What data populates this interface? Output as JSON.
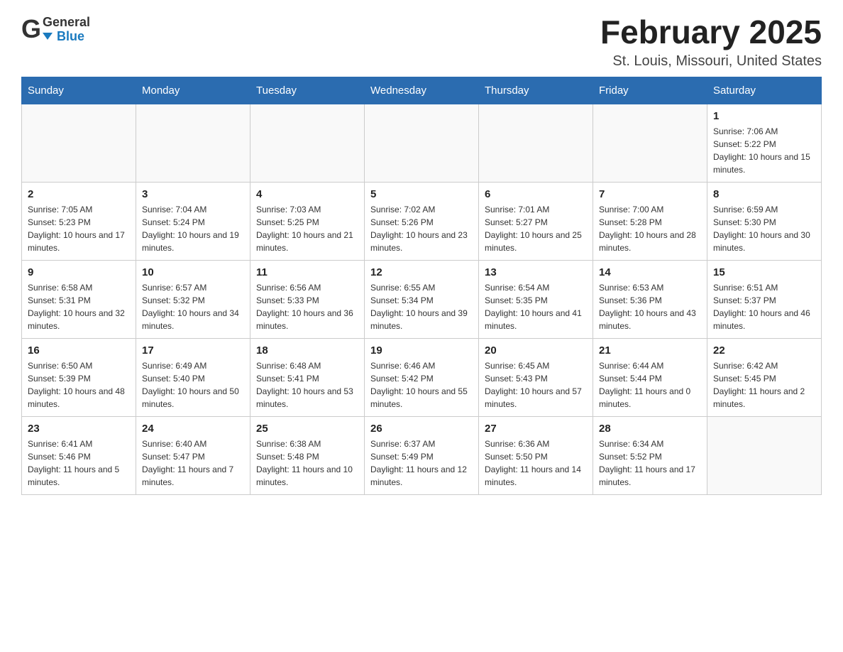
{
  "header": {
    "logo": {
      "general": "General",
      "arrow": "▶",
      "blue": "Blue"
    },
    "title": "February 2025",
    "location": "St. Louis, Missouri, United States"
  },
  "weekdays": [
    "Sunday",
    "Monday",
    "Tuesday",
    "Wednesday",
    "Thursday",
    "Friday",
    "Saturday"
  ],
  "weeks": [
    [
      {
        "day": "",
        "info": ""
      },
      {
        "day": "",
        "info": ""
      },
      {
        "day": "",
        "info": ""
      },
      {
        "day": "",
        "info": ""
      },
      {
        "day": "",
        "info": ""
      },
      {
        "day": "",
        "info": ""
      },
      {
        "day": "1",
        "info": "Sunrise: 7:06 AM\nSunset: 5:22 PM\nDaylight: 10 hours and 15 minutes."
      }
    ],
    [
      {
        "day": "2",
        "info": "Sunrise: 7:05 AM\nSunset: 5:23 PM\nDaylight: 10 hours and 17 minutes."
      },
      {
        "day": "3",
        "info": "Sunrise: 7:04 AM\nSunset: 5:24 PM\nDaylight: 10 hours and 19 minutes."
      },
      {
        "day": "4",
        "info": "Sunrise: 7:03 AM\nSunset: 5:25 PM\nDaylight: 10 hours and 21 minutes."
      },
      {
        "day": "5",
        "info": "Sunrise: 7:02 AM\nSunset: 5:26 PM\nDaylight: 10 hours and 23 minutes."
      },
      {
        "day": "6",
        "info": "Sunrise: 7:01 AM\nSunset: 5:27 PM\nDaylight: 10 hours and 25 minutes."
      },
      {
        "day": "7",
        "info": "Sunrise: 7:00 AM\nSunset: 5:28 PM\nDaylight: 10 hours and 28 minutes."
      },
      {
        "day": "8",
        "info": "Sunrise: 6:59 AM\nSunset: 5:30 PM\nDaylight: 10 hours and 30 minutes."
      }
    ],
    [
      {
        "day": "9",
        "info": "Sunrise: 6:58 AM\nSunset: 5:31 PM\nDaylight: 10 hours and 32 minutes."
      },
      {
        "day": "10",
        "info": "Sunrise: 6:57 AM\nSunset: 5:32 PM\nDaylight: 10 hours and 34 minutes."
      },
      {
        "day": "11",
        "info": "Sunrise: 6:56 AM\nSunset: 5:33 PM\nDaylight: 10 hours and 36 minutes."
      },
      {
        "day": "12",
        "info": "Sunrise: 6:55 AM\nSunset: 5:34 PM\nDaylight: 10 hours and 39 minutes."
      },
      {
        "day": "13",
        "info": "Sunrise: 6:54 AM\nSunset: 5:35 PM\nDaylight: 10 hours and 41 minutes."
      },
      {
        "day": "14",
        "info": "Sunrise: 6:53 AM\nSunset: 5:36 PM\nDaylight: 10 hours and 43 minutes."
      },
      {
        "day": "15",
        "info": "Sunrise: 6:51 AM\nSunset: 5:37 PM\nDaylight: 10 hours and 46 minutes."
      }
    ],
    [
      {
        "day": "16",
        "info": "Sunrise: 6:50 AM\nSunset: 5:39 PM\nDaylight: 10 hours and 48 minutes."
      },
      {
        "day": "17",
        "info": "Sunrise: 6:49 AM\nSunset: 5:40 PM\nDaylight: 10 hours and 50 minutes."
      },
      {
        "day": "18",
        "info": "Sunrise: 6:48 AM\nSunset: 5:41 PM\nDaylight: 10 hours and 53 minutes."
      },
      {
        "day": "19",
        "info": "Sunrise: 6:46 AM\nSunset: 5:42 PM\nDaylight: 10 hours and 55 minutes."
      },
      {
        "day": "20",
        "info": "Sunrise: 6:45 AM\nSunset: 5:43 PM\nDaylight: 10 hours and 57 minutes."
      },
      {
        "day": "21",
        "info": "Sunrise: 6:44 AM\nSunset: 5:44 PM\nDaylight: 11 hours and 0 minutes."
      },
      {
        "day": "22",
        "info": "Sunrise: 6:42 AM\nSunset: 5:45 PM\nDaylight: 11 hours and 2 minutes."
      }
    ],
    [
      {
        "day": "23",
        "info": "Sunrise: 6:41 AM\nSunset: 5:46 PM\nDaylight: 11 hours and 5 minutes."
      },
      {
        "day": "24",
        "info": "Sunrise: 6:40 AM\nSunset: 5:47 PM\nDaylight: 11 hours and 7 minutes."
      },
      {
        "day": "25",
        "info": "Sunrise: 6:38 AM\nSunset: 5:48 PM\nDaylight: 11 hours and 10 minutes."
      },
      {
        "day": "26",
        "info": "Sunrise: 6:37 AM\nSunset: 5:49 PM\nDaylight: 11 hours and 12 minutes."
      },
      {
        "day": "27",
        "info": "Sunrise: 6:36 AM\nSunset: 5:50 PM\nDaylight: 11 hours and 14 minutes."
      },
      {
        "day": "28",
        "info": "Sunrise: 6:34 AM\nSunset: 5:52 PM\nDaylight: 11 hours and 17 minutes."
      },
      {
        "day": "",
        "info": ""
      }
    ]
  ]
}
